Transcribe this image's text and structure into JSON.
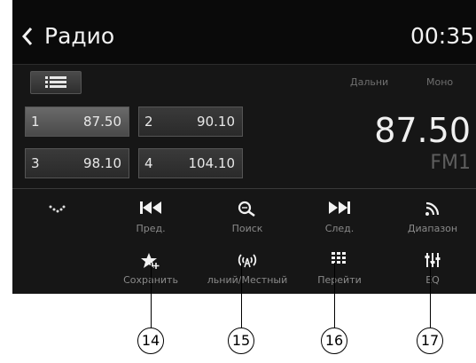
{
  "header": {
    "back_icon": "chevron-left-icon",
    "title": "Радио",
    "clock": "00:35"
  },
  "status": {
    "distance": "Дальни",
    "stereo": "Моно"
  },
  "presets": [
    {
      "num": "1",
      "freq": "87.50",
      "selected": true
    },
    {
      "num": "2",
      "freq": "90.10",
      "selected": false
    },
    {
      "num": "3",
      "freq": "98.10",
      "selected": false
    },
    {
      "num": "4",
      "freq": "104.10",
      "selected": false
    }
  ],
  "tuner": {
    "frequency": "87.50",
    "band": "FM1"
  },
  "controls_row1": [
    {
      "icon": "chevron-down-icon",
      "label": ""
    },
    {
      "icon": "previous-icon",
      "label": "Пред."
    },
    {
      "icon": "search-icon",
      "label": "Поиск"
    },
    {
      "icon": "next-icon",
      "label": "След."
    },
    {
      "icon": "band-icon",
      "label": "Диапазон"
    }
  ],
  "controls_row2": [
    {
      "icon": "star-add-icon",
      "label": "Сохранить"
    },
    {
      "icon": "antenna-icon",
      "label": "льний/Местный"
    },
    {
      "icon": "keypad-icon",
      "label": "Перейти"
    },
    {
      "icon": "equalizer-icon",
      "label": "EQ"
    }
  ],
  "callouts": [
    "14",
    "15",
    "16",
    "17"
  ],
  "colors": {
    "screen_bg": "#161616",
    "header_bg": "#0a0a0a",
    "text": "#f2f2f2",
    "muted": "#8a8a8a"
  }
}
